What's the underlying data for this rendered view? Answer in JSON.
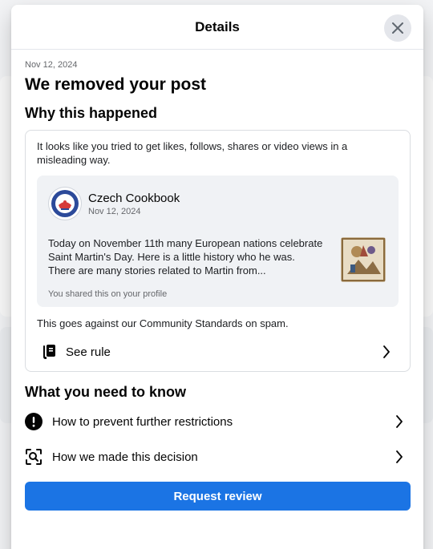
{
  "dialog": {
    "title": "Details",
    "date": "Nov 12, 2024",
    "heading": "We removed your post",
    "why_title": "Why this happened",
    "reason": "It looks like you tried to get likes, follows, shares or video views in a misleading way.",
    "post": {
      "author": "Czech Cookbook",
      "avatar_label": "CZECH COOKBOOK",
      "date": "Nov 12, 2024",
      "text": "Today on November 11th many European nations celebrate Saint Martin's Day. Here is a little history who he was. There are many stories related to Martin from...",
      "caption": "You shared this on your profile"
    },
    "standards": "This goes against our Community Standards on spam.",
    "see_rule": "See rule",
    "need_title": "What you need to know",
    "need_items": [
      {
        "label": "How to prevent further restrictions",
        "icon": "alert-icon"
      },
      {
        "label": "How we made this decision",
        "icon": "search-decision-icon"
      }
    ],
    "primary_button": "Request review"
  },
  "colors": {
    "accent": "#1b74e4",
    "text": "#050505",
    "muted": "#65676b",
    "card": "#f0f2f5"
  }
}
